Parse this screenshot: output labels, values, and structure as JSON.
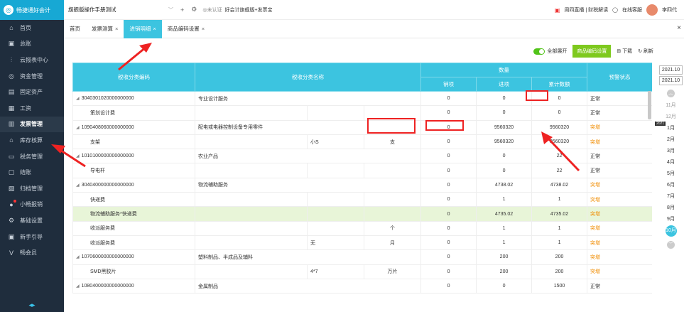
{
  "brand": {
    "logo_text": "畅捷通好会计"
  },
  "sidebar": {
    "items": [
      {
        "icon": "⌂",
        "label": "首页",
        "active": false
      },
      {
        "icon": "▣",
        "label": "总账",
        "active": false
      },
      {
        "icon": "⫶",
        "label": "云报表中心",
        "active": false
      },
      {
        "icon": "◎",
        "label": "资金管理",
        "active": false
      },
      {
        "icon": "▤",
        "label": "固定资产",
        "active": false
      },
      {
        "icon": "▦",
        "label": "工资",
        "active": false
      },
      {
        "icon": "▥",
        "label": "发票管理",
        "active": true
      },
      {
        "icon": "⌂",
        "label": "库存核算",
        "active": false
      },
      {
        "icon": "▭",
        "label": "税务管理",
        "active": false
      },
      {
        "icon": "▢",
        "label": "结账",
        "active": false
      },
      {
        "icon": "▧",
        "label": "归档管理",
        "active": false
      },
      {
        "icon": "●",
        "label": "小畅报销",
        "active": false
      },
      {
        "icon": "⚙",
        "label": "基础设置",
        "active": false
      },
      {
        "icon": "▣",
        "label": "新手引导",
        "active": false
      },
      {
        "icon": "V",
        "label": "畅会员",
        "active": false
      }
    ]
  },
  "topbar": {
    "company": "旗舰版操作手册测试",
    "badge": "◎未认证",
    "account": "好会计旗舰版+发票宝",
    "live": "周四直播 | 财税解读",
    "service": "在线客服",
    "user": "李四代"
  },
  "tabs": [
    {
      "label": "首页",
      "closable": false,
      "active": false
    },
    {
      "label": "发票测算",
      "closable": true,
      "active": false
    },
    {
      "label": "进销明细",
      "closable": true,
      "active": true
    },
    {
      "label": "商品编码设置",
      "closable": true,
      "active": false
    }
  ],
  "toolbar": {
    "expand_all": "全部展开",
    "settings_btn": "商品编码设置",
    "download": "下载",
    "refresh": "刷新"
  },
  "table": {
    "h_code": "税收分类编码",
    "h_name": "税收分类名称",
    "h_qty": "数量",
    "h_out": "销项",
    "h_in": "进项",
    "h_cum": "累计数额",
    "h_status": "预警状态",
    "rows": [
      {
        "code": "3040301020000000000",
        "name": "专业设计服务",
        "spec": "",
        "unit": "",
        "out": "0",
        "in": "0",
        "cum": "0",
        "status": "正常",
        "level": 0,
        "hl": false
      },
      {
        "code": "策划设计费",
        "name": "",
        "spec": "",
        "unit": "",
        "out": "0",
        "in": "0",
        "cum": "0",
        "status": "正常",
        "level": 1,
        "hl": false
      },
      {
        "code": "1090408060000000000",
        "name": "配电或电器控制设备专用零件",
        "spec": "",
        "unit": "",
        "out": "0",
        "in": "9560320",
        "cum": "9560320",
        "status": "突增",
        "level": 0,
        "hl": false
      },
      {
        "code": "支架",
        "name": "",
        "spec": "小S",
        "unit": "支",
        "out": "0",
        "in": "9560320",
        "cum": "9560320",
        "status": "突增",
        "level": 1,
        "hl": false
      },
      {
        "code": "1010100000000000000",
        "name": "农业产品",
        "spec": "",
        "unit": "",
        "out": "0",
        "in": "0",
        "cum": "22",
        "status": "正常",
        "level": 0,
        "hl": false
      },
      {
        "code": "导电杆",
        "name": "",
        "spec": "",
        "unit": "",
        "out": "0",
        "in": "0",
        "cum": "22",
        "status": "正常",
        "level": 1,
        "hl": false
      },
      {
        "code": "3040400000000000000",
        "name": "物流辅助服务",
        "spec": "",
        "unit": "",
        "out": "0",
        "in": "4738.02",
        "cum": "4738.02",
        "status": "突增",
        "level": 0,
        "hl": false
      },
      {
        "code": "快递费",
        "name": "",
        "spec": "",
        "unit": "",
        "out": "0",
        "in": "1",
        "cum": "1",
        "status": "突增",
        "level": 1,
        "hl": false
      },
      {
        "code": "物流辅助服务*快递费",
        "name": "",
        "spec": "",
        "unit": "",
        "out": "0",
        "in": "4735.02",
        "cum": "4735.02",
        "status": "突增",
        "level": 1,
        "hl": true
      },
      {
        "code": "收派服务费",
        "name": "",
        "spec": "",
        "unit": "个",
        "out": "0",
        "in": "1",
        "cum": "1",
        "status": "突增",
        "level": 1,
        "hl": false
      },
      {
        "code": "收派服务费",
        "name": "",
        "spec": "无",
        "unit": "月",
        "out": "0",
        "in": "1",
        "cum": "1",
        "status": "突增",
        "level": 1,
        "hl": false
      },
      {
        "code": "1070600000000000000",
        "name": "塑料制品、半成品及辅料",
        "spec": "",
        "unit": "",
        "out": "0",
        "in": "200",
        "cum": "200",
        "status": "突增",
        "level": 0,
        "hl": false
      },
      {
        "code": "SMD黑胶片",
        "name": "",
        "spec": "4*7",
        "unit": "万片",
        "out": "0",
        "in": "200",
        "cum": "200",
        "status": "突增",
        "level": 1,
        "hl": false
      },
      {
        "code": "1080400000000000000",
        "name": "金属制品",
        "spec": "",
        "unit": "",
        "out": "0",
        "in": "0",
        "cum": "1500",
        "status": "正常",
        "level": 0,
        "hl": false
      }
    ]
  },
  "year_panel": {
    "y1": "2021.10",
    "y2": "2021.10",
    "year_label": "2021",
    "months": [
      "11月",
      "12月",
      "1月",
      "2月",
      "3月",
      "4月",
      "5月",
      "6月",
      "7月",
      "8月",
      "9月",
      "10月"
    ]
  }
}
